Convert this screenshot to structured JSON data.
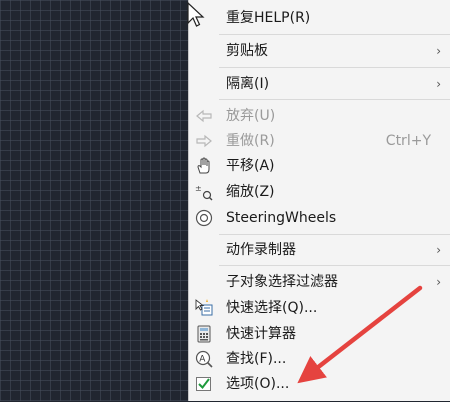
{
  "menu": {
    "repeat_help": "重复HELP(R)",
    "clipboard": "剪贴板",
    "isolate": "隔离(I)",
    "undo": "放弃(U)",
    "redo": "重做(R)",
    "redo_shortcut": "Ctrl+Y",
    "pan": "平移(A)",
    "zoom": "缩放(Z)",
    "steering_wheels": "SteeringWheels",
    "action_recorder": "动作录制器",
    "subobject_filter": "子对象选择过滤器",
    "quick_select": "快速选择(Q)...",
    "quick_calc": "快速计算器",
    "find": "查找(F)...",
    "options": "选项(O)...",
    "submenu_arrow": "›"
  },
  "colors": {
    "canvas_bg": "#212630",
    "menu_bg": "#f4f4f4",
    "annotation_arrow": "#e5433f"
  }
}
